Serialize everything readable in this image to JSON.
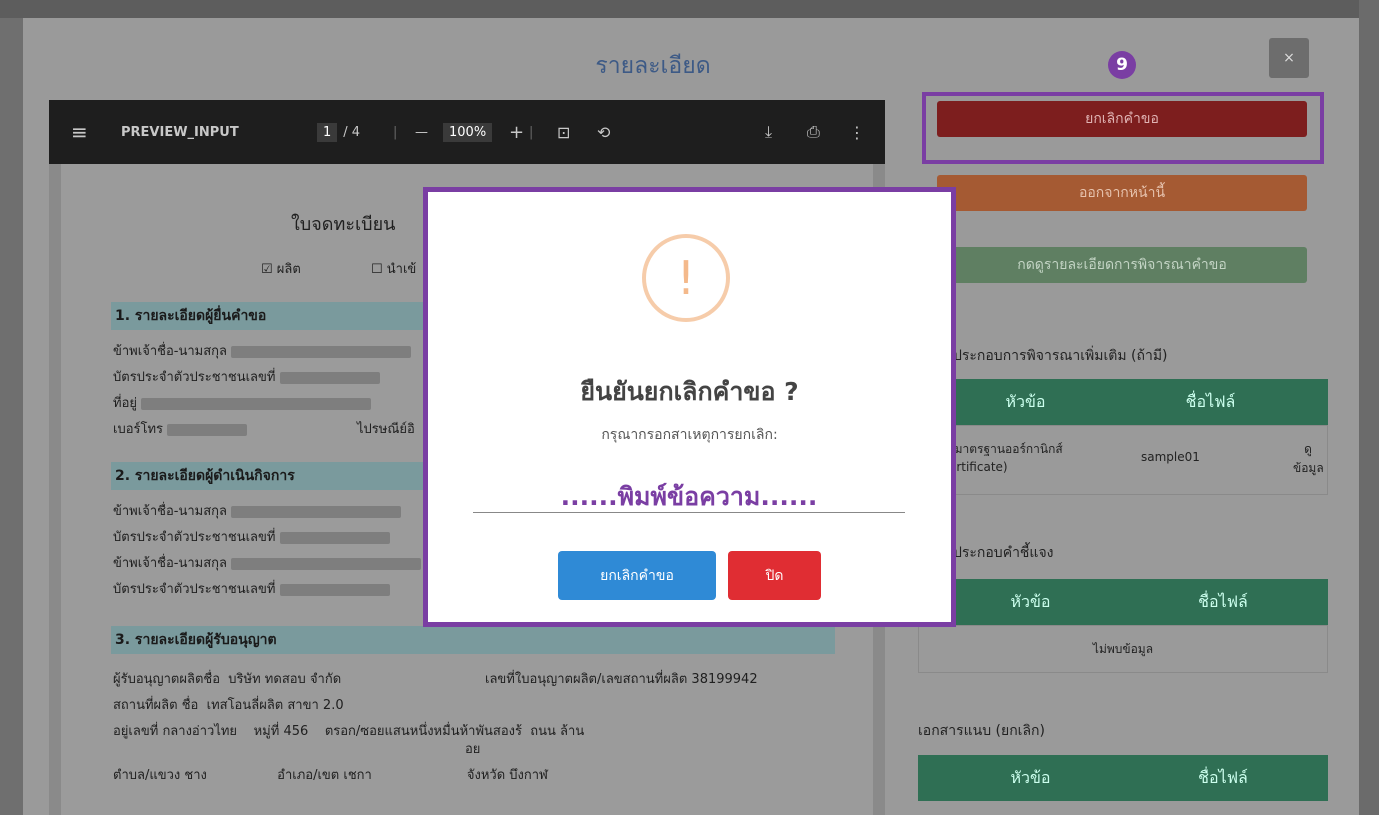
{
  "modal": {
    "title": "รายละเอียด",
    "close_label": "×",
    "step_badge": "9"
  },
  "pdf": {
    "doc_name": "PREVIEW_INPUT",
    "page_current": "1",
    "page_total": "/ 4",
    "zoom": "100%",
    "zoom_out": "—",
    "zoom_in": "+",
    "doc_title": "ใบจดทะเบียน",
    "check_1": "☑ ผลิต",
    "check_2": "☐ นำเข้",
    "sec1": "1. รายละเอียดผู้ยื่นคำขอ",
    "s1_l1": "ข้าพเจ้าชื่อ-นามสกุล",
    "s1_l2": "บัตรประจำตัวประชาชนเลขที่",
    "s1_l3": "ที่อยู่",
    "s1_l4": "เบอร์โทร",
    "s1_l4b": "ไปรษณีย์อิ",
    "sec2": "2. รายละเอียดผู้ดำเนินกิจการ",
    "s2_l1": "ข้าพเจ้าชื่อ-นามสกุล",
    "s2_l2": "บัตรประจำตัวประชาชนเลขที่",
    "s2_l3": "ข้าพเจ้าชื่อ-นามสกุล",
    "s2_l4": "บัตรประจำตัวประชาชนเลขที่",
    "sec3": "3. รายละเอียดผู้รับอนุญาต",
    "s3_l1a": "ผู้รับอนุญาตผลิตชื่อ",
    "s3_l1b": "บริษัท ทดสอบ จำกัด",
    "s3_l1c": "เลขที่ใบอนุญาตผลิต/เลขสถานที่ผลิต",
    "s3_l1d": "38199942",
    "s3_l2a": "สถานที่ผลิต ชื่อ",
    "s3_l2b": "เทสโอนลี่ผลิต สาขา 2.0",
    "s3_l3a": "อยู่เลขที่",
    "s3_l3b": "กลางอ่าวไทย",
    "s3_l3c": "หมู่ที่",
    "s3_l3d": "456",
    "s3_l3e": "ตรอก/ซอย",
    "s3_l3f": "แสนหนึ่งหมื่นห้าพันสองร้",
    "s3_l3g": "ถนน",
    "s3_l3h": "ล้าน",
    "s3_l3i": "อย",
    "s3_l4a": "ตำบล/แขวง",
    "s3_l4b": "ชาง",
    "s3_l4c": "อำเภอ/เขต",
    "s3_l4d": "เชกา",
    "s3_l4e": "จังหวัด",
    "s3_l4f": "บึงกาฬ"
  },
  "side": {
    "btn_cancel": "ยกเลิกคำขอ",
    "btn_exit": "ออกจากหน้านี้",
    "btn_view": "กดดูรายละเอียดการพิจารณาคำขอ",
    "sec_attach_extra": "รแนบประกอบการพิจารณาเพิ่มเติม (ถ้ามี)",
    "col_topic": "หัวข้อ",
    "col_file": "ชื่อไฟล์",
    "row1_topic_a": "รับรองมาตรฐานออร์กานิกส์",
    "row1_topic_b": "nic certificate)",
    "row1_file": "sample01",
    "row1_action_a": "ดู",
    "row1_action_b": "ข้อมูล",
    "sec_attach_explain": "รแนบประกอบคำชี้แจง",
    "no_data": "ไม่พบข้อมูล",
    "sec_attach_cancel": "เอกสารแนบ (ยกเลิก)"
  },
  "dialog": {
    "icon": "!",
    "title": "ยืนยันยกเลิกคำขอ ?",
    "subtitle": "กรุณากรอกสาเหตุการยกเลิก:",
    "input_value": "......พิมพ์ข้อความ......",
    "confirm_label": "ยกเลิกคำขอ",
    "close_label": "ปิด"
  }
}
